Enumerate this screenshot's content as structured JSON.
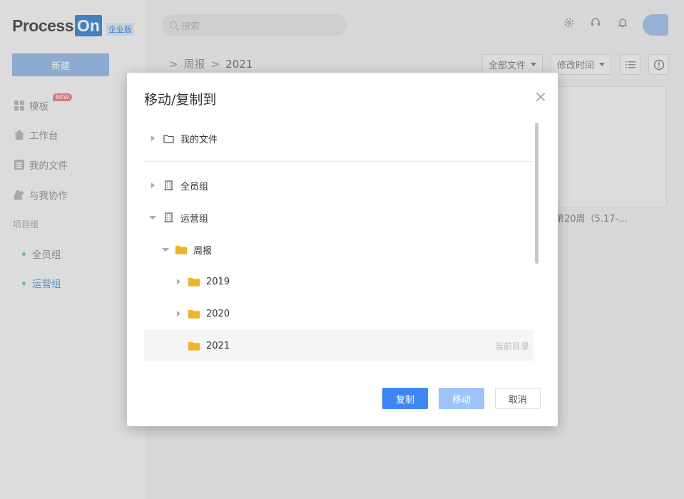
{
  "brand": {
    "name_part1": "Process",
    "name_part2": "On",
    "edition": "企业版"
  },
  "sidebar": {
    "new_button": "新建",
    "nav": [
      {
        "label": "模板",
        "icon": "template-grid-icon",
        "badge": "NEW"
      },
      {
        "label": "工作台",
        "icon": "home-icon"
      },
      {
        "label": "我的文件",
        "icon": "document-icon"
      },
      {
        "label": "与我协作",
        "icon": "users-icon"
      }
    ],
    "section_label": "项目组",
    "groups": [
      {
        "label": "全员组",
        "active": false
      },
      {
        "label": "运营组",
        "active": true
      }
    ]
  },
  "header": {
    "search_placeholder": "搜索",
    "icons": [
      "settings-icon",
      "headset-icon",
      "bell-icon",
      "avatar"
    ]
  },
  "breadcrumb": {
    "items": [
      "周报",
      "2021"
    ],
    "separator": ">"
  },
  "toolbar": {
    "filter_label": "全部文件",
    "sort_label": "修改时间"
  },
  "files": [
    {
      "name": "第20周（5.17-..."
    }
  ],
  "modal": {
    "title": "移动/复制到",
    "tree": [
      {
        "label": "我的文件",
        "icon": "folder-outline-icon",
        "expand": "collapsed",
        "level": 0
      },
      {
        "label": "全员组",
        "icon": "building-icon",
        "expand": "collapsed",
        "level": 0
      },
      {
        "label": "运营组",
        "icon": "building-icon",
        "expand": "expanded",
        "level": 0
      },
      {
        "label": "周报",
        "icon": "folder-icon",
        "expand": "expanded",
        "level": 1
      },
      {
        "label": "2019",
        "icon": "folder-icon",
        "expand": "collapsed",
        "level": 2
      },
      {
        "label": "2020",
        "icon": "folder-icon",
        "expand": "collapsed",
        "level": 2
      },
      {
        "label": "2021",
        "icon": "folder-icon",
        "expand": "none",
        "level": 2,
        "current": true,
        "tag": "当前目录"
      }
    ],
    "buttons": {
      "copy": "复制",
      "move": "移动",
      "cancel": "取消"
    }
  },
  "colors": {
    "primary": "#3f86f5",
    "primary_disabled": "#9ec3f9",
    "folder": "#f0b429",
    "accent_dot": "#7fc9a8"
  }
}
